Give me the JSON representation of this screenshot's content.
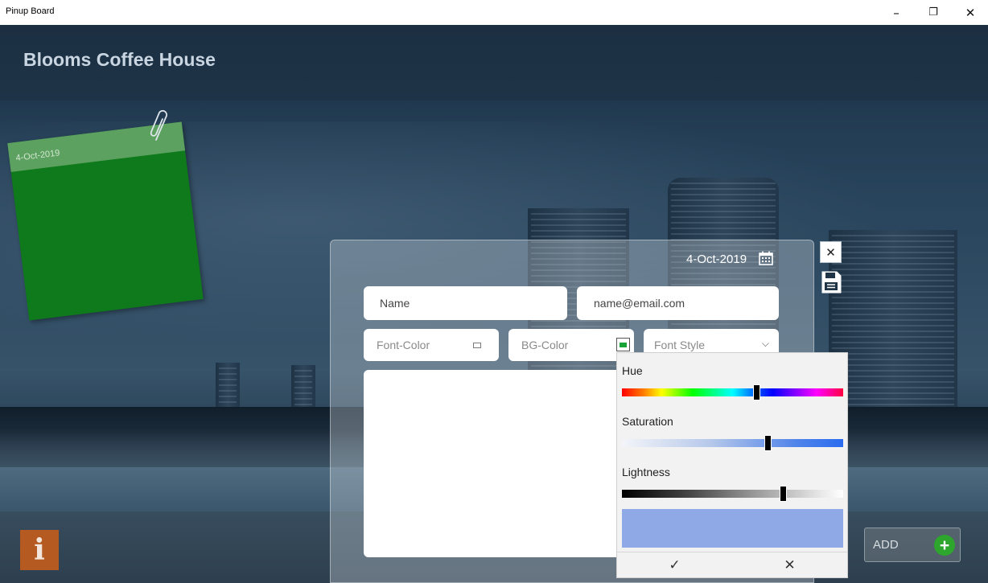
{
  "window": {
    "title": "Pinup Board",
    "minimize_glyph": "–",
    "maximize_glyph": "❐",
    "close_glyph": "✕"
  },
  "header": {
    "title": "Blooms Coffee House"
  },
  "board": {
    "notes": [
      {
        "date": "4-Oct-2019",
        "color": "#0f7a1b"
      }
    ]
  },
  "form": {
    "date": "4-Oct-2019",
    "close_glyph": "✕",
    "name_field": "Name",
    "email_field": "name@email.com",
    "font_color_field": "Font-Color",
    "bg_color_field": "BG-Color",
    "font_style_field": "Font Style",
    "font_style_chevron": "⌵",
    "bg_color_value": "#18a339"
  },
  "color_picker": {
    "hue_label": "Hue",
    "saturation_label": "Saturation",
    "lightness_label": "Lightness",
    "hue_value": 0.61,
    "saturation_value": 0.66,
    "lightness_value": 0.73,
    "preview_color": "#8fa9e6",
    "ok_glyph": "✓",
    "cancel_glyph": "✕"
  },
  "footer": {
    "info_label": "i",
    "add_label": "ADD",
    "add_plus": "+",
    "accent": "#2ea52c"
  }
}
